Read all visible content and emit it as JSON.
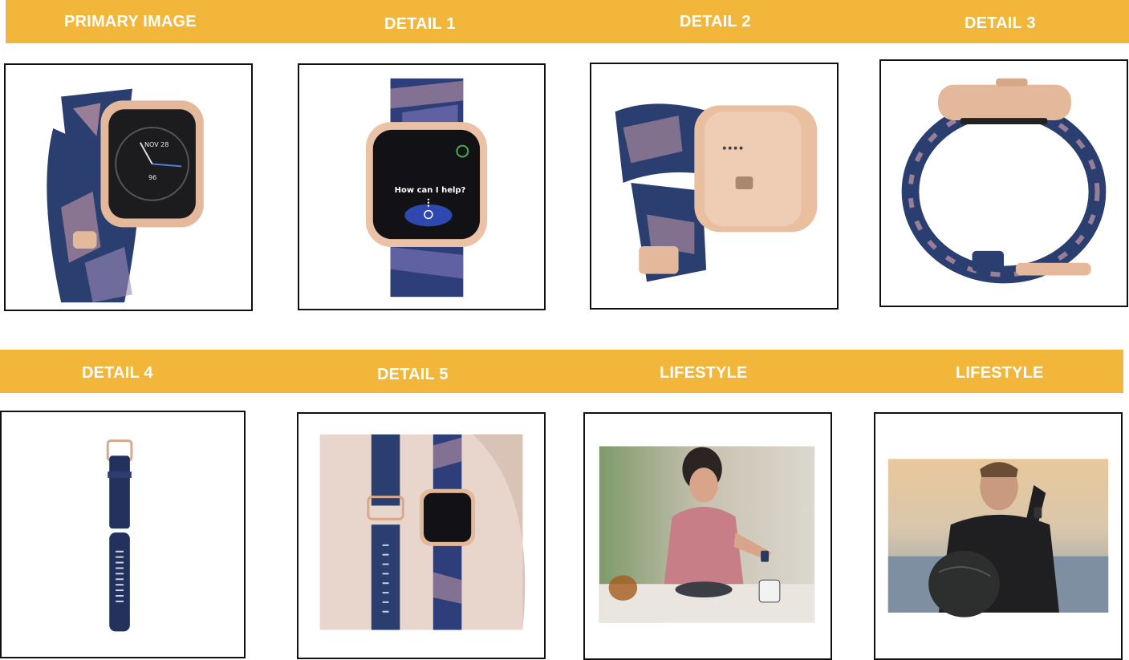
{
  "rows": [
    {
      "panels": [
        {
          "label": "PRIMARY IMAGE",
          "image": "watch-three-quarter"
        },
        {
          "label": "DETAIL 1",
          "image": "watch-front"
        },
        {
          "label": "DETAIL 2",
          "image": "watch-back"
        },
        {
          "label": "DETAIL 3",
          "image": "watch-side"
        }
      ]
    },
    {
      "panels": [
        {
          "label": "DETAIL 4",
          "image": "spare-band"
        },
        {
          "label": "DETAIL 5",
          "image": "flatlay-bands"
        },
        {
          "label": "LIFESTYLE",
          "image": "woman-breakfast"
        },
        {
          "label": "LIFESTYLE",
          "image": "man-workout"
        }
      ]
    }
  ],
  "watch_face": {
    "date": "NOV 28",
    "heart_rate": "96"
  },
  "assistant_prompt": "How can I help?",
  "colors": {
    "band": "#F2B73A",
    "label_text": "#FFFFFF",
    "frame_border": "#111111",
    "strap_navy": "#2A3F70",
    "rose_gold": "#E4B89B"
  }
}
